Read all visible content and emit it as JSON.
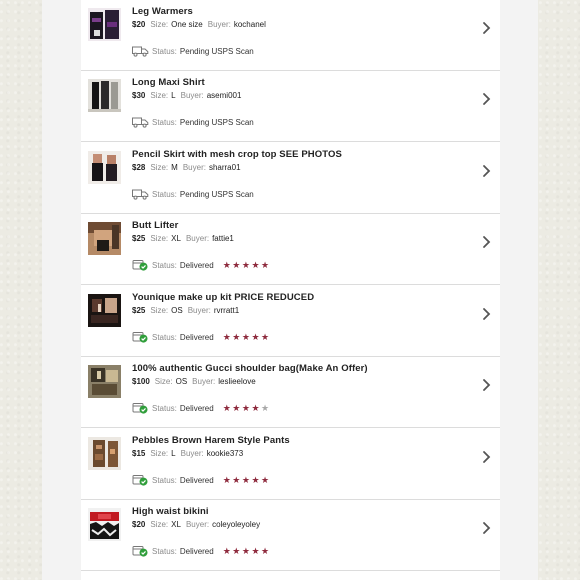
{
  "colors": {
    "star_filled": "#8e2a3d",
    "star_empty": "#a8a8a8",
    "delivered_check": "#2f9e3a",
    "text": "#222222",
    "muted": "#8a8a8a"
  },
  "labels": {
    "size": "Size:",
    "buyer": "Buyer:",
    "status": "Status:"
  },
  "items": [
    {
      "title": "Leg Warmers",
      "price": "$20",
      "size": "One size",
      "buyer": "kochanel",
      "status": "Pending USPS Scan",
      "status_icon": "shipping-truck-icon",
      "rating": null
    },
    {
      "title": "Long Maxi Shirt",
      "price": "$30",
      "size": "L",
      "buyer": "asemi001",
      "status": "Pending USPS Scan",
      "status_icon": "shipping-truck-icon",
      "rating": null
    },
    {
      "title": "Pencil Skirt with mesh crop top SEE PHOTOS",
      "price": "$28",
      "size": "M",
      "buyer": "sharra01",
      "status": "Pending USPS Scan",
      "status_icon": "shipping-truck-icon",
      "rating": null
    },
    {
      "title": "Butt Lifter",
      "price": "$25",
      "size": "XL",
      "buyer": "fattie1",
      "status": "Delivered",
      "status_icon": "delivered-check-icon",
      "rating": 5
    },
    {
      "title": "Younique make up kit PRICE REDUCED",
      "price": "$25",
      "size": "OS",
      "buyer": "rvrratt1",
      "status": "Delivered",
      "status_icon": "delivered-check-icon",
      "rating": 5
    },
    {
      "title": "100% authentic Gucci shoulder bag(Make An Offer)",
      "price": "$100",
      "size": "OS",
      "buyer": "leslieelove",
      "status": "Delivered",
      "status_icon": "delivered-check-icon",
      "rating": 4
    },
    {
      "title": "Pebbles Brown Harem Style Pants",
      "price": "$15",
      "size": "L",
      "buyer": "kookie373",
      "status": "Delivered",
      "status_icon": "delivered-check-icon",
      "rating": 5
    },
    {
      "title": "High waist bikini",
      "price": "$20",
      "size": "XL",
      "buyer": "coleyoleyoley",
      "status": "Delivered",
      "status_icon": "delivered-check-icon",
      "rating": 5
    }
  ]
}
